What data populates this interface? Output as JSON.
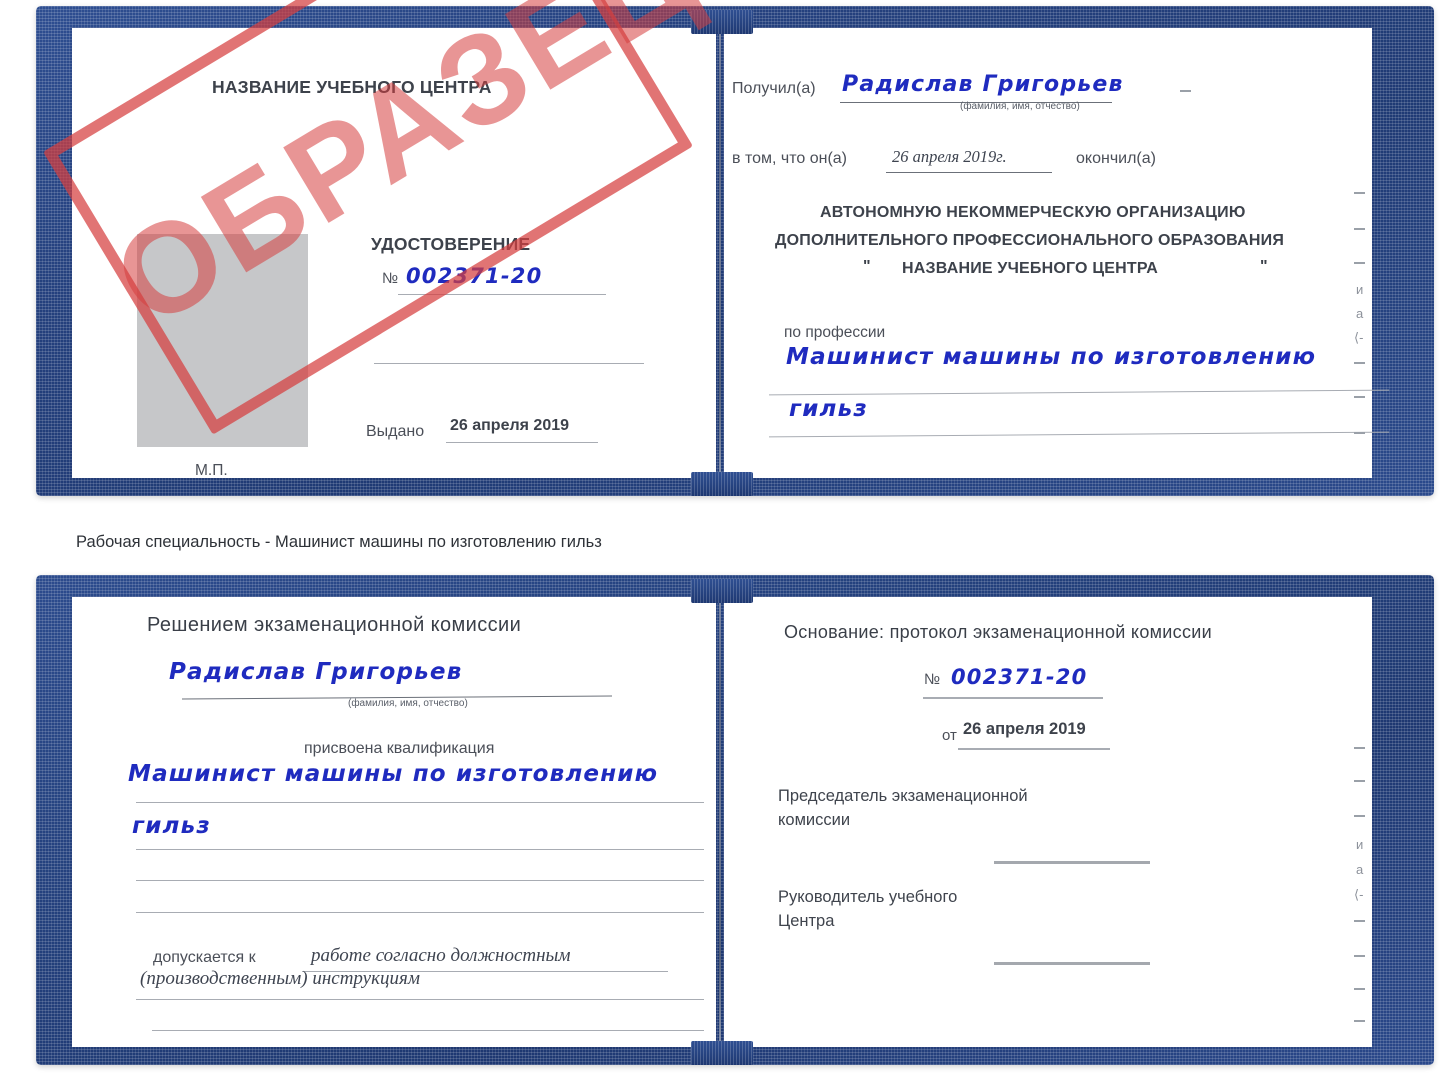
{
  "document": {
    "type": "Удостоверение (сертификат) — образец",
    "watermark": "ОБРАЗЕЦ",
    "accent_blue": "#23407c",
    "ink_blue": "#1f2bbf",
    "stamp_red": "#d63e3e"
  },
  "caption": "Рабочая специальность - Машинист машины по изготовлению гильз",
  "cert_top": {
    "left_page": {
      "org_title": "НАЗВАНИЕ УЧЕБНОГО ЦЕНТРА",
      "doc_title": "УДОСТОВЕРЕНИЕ",
      "number_label": "№",
      "number_value": "002371-20",
      "issued_label": "Выдано",
      "issued_value": "26 апреля 2019",
      "seal_label": "М.П."
    },
    "right_page": {
      "received_label": "Получил(а)",
      "received_value": "Радислав Григорьев",
      "fio_hint": "(фамилия, имя, отчество)",
      "that_he_label": "в том, что он(а)",
      "that_he_value": "26 апреля 2019г.",
      "finished_label": "окончил(а)",
      "org_line1": "АВТОНОМНУЮ НЕКОММЕРЧЕСКУЮ ОРГАНИЗАЦИЮ",
      "org_line2": "ДОПОЛНИТЕЛЬНОГО ПРОФЕССИОНАЛЬНОГО ОБРАЗОВАНИЯ",
      "org_quote_open": "\"",
      "org_line3": "НАЗВАНИЕ УЧЕБНОГО ЦЕНТРА",
      "org_quote_close": "\"",
      "profession_label": "по профессии",
      "profession_value_line1": "Машинист машины по изготовлению",
      "profession_value_line2": "гильз",
      "edge_marks": [
        "и",
        "а",
        "⟨-"
      ]
    }
  },
  "cert_bottom": {
    "left_page": {
      "heading": "Решением экзаменационной комиссии",
      "name_value": "Радислав Григорьев",
      "fio_hint": "(фамилия, имя, отчество)",
      "qualification_label": "присвоена квалификация",
      "qualification_line1": "Машинист машины по изготовлению",
      "qualification_line2": "гильз",
      "admitted_label": "допускается к",
      "admitted_line1": "работе согласно должностным",
      "admitted_line2": "(производственным) инструкциям"
    },
    "right_page": {
      "basis_label": "Основание: протокол экзаменационной комиссии",
      "number_label": "№",
      "number_value": "002371-20",
      "date_label": "от",
      "date_value": "26 апреля 2019",
      "chairman_line1": "Председатель экзаменационной",
      "chairman_line2": "комиссии",
      "head_line1": "Руководитель учебного",
      "head_line2": "Центра",
      "edge_marks": [
        "и",
        "а",
        "⟨-"
      ]
    }
  }
}
